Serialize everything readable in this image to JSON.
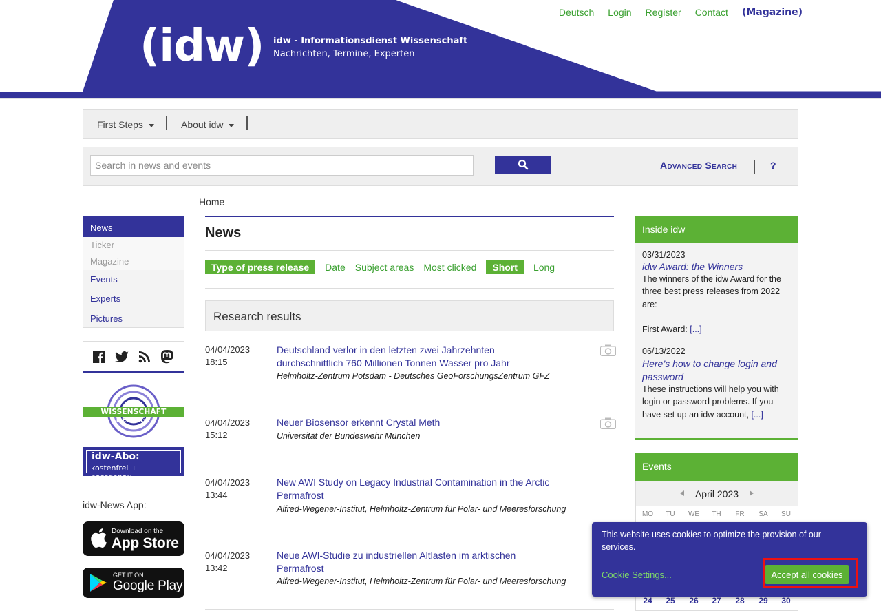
{
  "header": {
    "logo": "(idw)",
    "tagline_title": "idw - Informationsdienst Wissenschaft",
    "tagline_sub": "Nachrichten, Termine, Experten",
    "top_links": [
      "Deutsch",
      "Login",
      "Register",
      "Contact"
    ],
    "magazine_link": "(Magazine)"
  },
  "nav": {
    "first_steps": "First Steps",
    "about": "About idw"
  },
  "search": {
    "placeholder": "Search in news and events",
    "advanced": "Advanced Search",
    "help": "?"
  },
  "breadcrumb": "Home",
  "sidebar": {
    "items": [
      "News",
      "Ticker",
      "Magazine",
      "Events",
      "Experts",
      "Pictures"
    ],
    "social_icons": [
      "facebook-icon",
      "twitter-icon",
      "rss-icon",
      "mastodon-icon"
    ],
    "wb_logo_text": "WISSENSCHAFT BEWEGT",
    "abo_title": "idw-Abo:",
    "abo_sub": "kostenfrei + passgenau",
    "app_label": "idw-News App:",
    "appstore_small": "Download on the",
    "appstore_big": "App Store",
    "googleplay_small": "GET IT ON",
    "googleplay_big": "Google Play"
  },
  "main": {
    "title": "News",
    "filters": {
      "type": "Type of press release",
      "date": "Date",
      "subject": "Subject areas",
      "most_clicked": "Most clicked",
      "short": "Short",
      "long": "Long"
    },
    "section": "Research results",
    "news": [
      {
        "date": "04/04/2023",
        "time": "18:15",
        "title": "Deutschland verlor in den letzten zwei Jahrzehnten durchschnittlich 760 Millionen Tonnen Wasser pro Jahr",
        "source": "Helmholtz-Zentrum Potsdam - Deutsches GeoForschungsZentrum GFZ"
      },
      {
        "date": "04/04/2023",
        "time": "15:12",
        "title": "Neuer Biosensor erkennt Crystal Meth",
        "source": "Universität der Bundeswehr München"
      },
      {
        "date": "04/04/2023",
        "time": "13:44",
        "title": "New AWI Study on Legacy Industrial Contamination in the Arctic Permafrost",
        "source": "Alfred-Wegener-Institut, Helmholtz-Zentrum für Polar- und Meeresforschung"
      },
      {
        "date": "04/04/2023",
        "time": "13:42",
        "title": "Neue AWI-Studie zu industriellen Altlasten im arktischen Permafrost",
        "source": "Alfred-Wegener-Institut, Helmholtz-Zentrum für Polar- und Meeresforschung"
      }
    ]
  },
  "inside": {
    "title": "Inside idw",
    "items": [
      {
        "date": "03/31/2023",
        "title": "idw Award: the Winners",
        "text": "The winners of the idw Award for the three best press releases from 2022 are:",
        "text2": "First Award:",
        "more": "[...]"
      },
      {
        "date": "06/13/2022",
        "title": "Here’s how to change login and password",
        "text": "These instructions will help you with login or password problems. If you have set up an idw account,",
        "more": "[...]"
      }
    ]
  },
  "events": {
    "title": "Events",
    "month": "April 2023",
    "dow": [
      "MO",
      "TU",
      "WE",
      "TH",
      "FR",
      "SA",
      "SU"
    ],
    "last_row": [
      "24",
      "25",
      "26",
      "27",
      "28",
      "29",
      "30"
    ]
  },
  "cookie": {
    "text": "This website uses cookies to optimize the provision of our services.",
    "settings": "Cookie Settings...",
    "accept": "Accept all cookies"
  },
  "colors": {
    "brand": "#33339a",
    "accent": "#5cb135",
    "link_green": "#3aa030"
  }
}
